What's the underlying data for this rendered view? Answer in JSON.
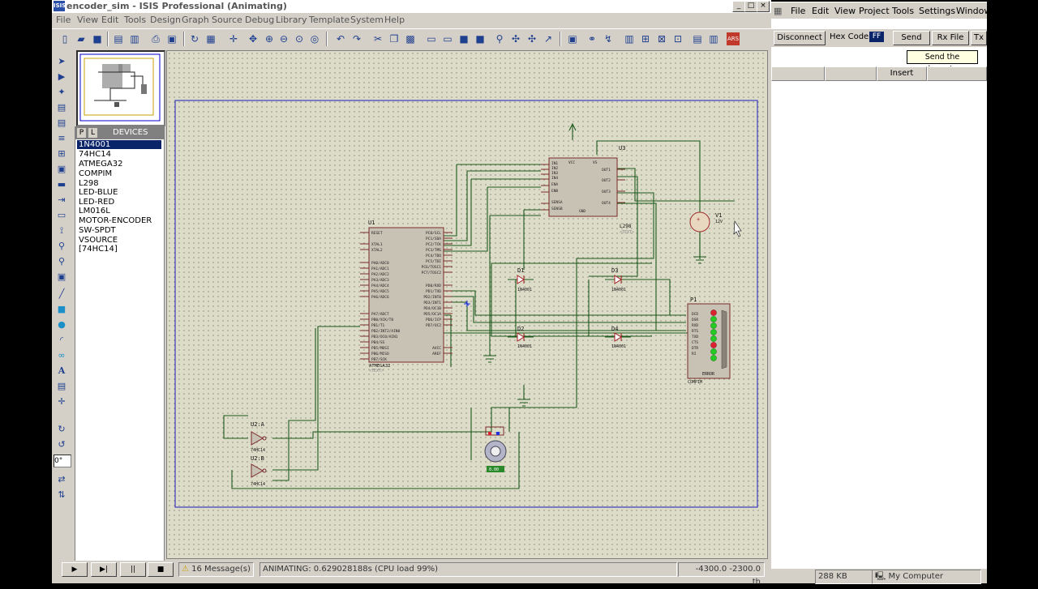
{
  "isis": {
    "title": "encoder_sim - ISIS Professional (Animating)",
    "app_icon": "ISIS",
    "menu": [
      "File",
      "View",
      "Edit",
      "Tools",
      "Design",
      "Graph",
      "Source",
      "Debug",
      "Library",
      "Template",
      "System",
      "Help"
    ],
    "devices_header": "DEVICES",
    "panel_tabs": [
      "P",
      "L"
    ],
    "devices": [
      "1N4001",
      "74HC14",
      "ATMEGA32",
      "COMPIM",
      "L298",
      "LED-BLUE",
      "LED-RED",
      "LM016L",
      "MOTOR-ENCODER",
      "SW-SPDT",
      "VSOURCE",
      "[74HC14]"
    ],
    "selected_device": "1N4001",
    "rotation": "0°",
    "status": {
      "messages": "16 Message(s)",
      "animating": "ANIMATING: 0.629028188s (CPU load 99%)",
      "coord_x": "-4300.0",
      "coord_y": "-2300.0",
      "units": "th"
    }
  },
  "schematic": {
    "u1_ref": "U1",
    "u1_part": "ATMEGA32",
    "u1_text": "<TEXT>",
    "u1_left_pins": [
      "RESET",
      "XTAL1",
      "XTAL2",
      "PA0/ADC0",
      "PA1/ADC1",
      "PA2/ADC2",
      "PA3/ADC3",
      "PA4/ADC4",
      "PA5/ADC5",
      "PA6/ADC6",
      "PA7/ADC7",
      "PB0/XCK/T0",
      "PB1/T1",
      "PB2/INT2/AIN0",
      "PB3/OC0/AIN1",
      "PB4/SS",
      "PB5/MOSI",
      "PB6/MISO",
      "PB7/SCK"
    ],
    "u1_right_pins": [
      "PC0/SCL",
      "PC1/SDA",
      "PC2/TCK",
      "PC3/TMS",
      "PC4/TDO",
      "PC5/TDI",
      "PC6/TOSC1",
      "PC7/TOSC2",
      "PD0/RXD",
      "PD1/TXD",
      "PD2/INT0",
      "PD3/INT1",
      "PD4/OC1B",
      "PD5/OC1A",
      "PD6/ICP",
      "PD7/OC2",
      "AVCC",
      "AREF"
    ],
    "u3_ref": "U3",
    "u3_part": "L298",
    "u3_text": "<TEXT>",
    "u3_left_pins": [
      "IN1",
      "IN2",
      "IN3",
      "IN4",
      "ENA",
      "ENB",
      "SENSA",
      "SENSB"
    ],
    "u3_top_pins": [
      "VCC",
      "VS"
    ],
    "u3_bottom_pin": "GND",
    "u3_right_pins": [
      "OUT1",
      "OUT2",
      "OUT3",
      "OUT4"
    ],
    "diodes": [
      "D1",
      "D2",
      "D3",
      "D4"
    ],
    "diode_part": "1N4001",
    "v1_ref": "V1",
    "v1_value": "12V",
    "p1_ref": "P1",
    "p1_part": "COMPIM",
    "p1_pins": [
      "DCD",
      "DSR",
      "RXD",
      "RTS",
      "TXD",
      "CTS",
      "DTR",
      "RI"
    ],
    "p1_error": "ERROR",
    "u2a_ref": "U2:A",
    "u2b_ref": "U2:B",
    "u2_part": "74HC14",
    "motor_label": "0.00"
  },
  "terminal": {
    "menu": [
      "File",
      "Edit",
      "View",
      "Project",
      "Tools",
      "Settings",
      "Windows"
    ],
    "disconnect": "Disconnect",
    "hex_code_label": "Hex Code:",
    "hex_value": "FF",
    "send": "Send",
    "rx_file": "Rx File",
    "tx": "Tx",
    "tooltip": "Send the character",
    "insert": "Insert",
    "status_size": "288 KB",
    "status_computer": "My Computer"
  }
}
